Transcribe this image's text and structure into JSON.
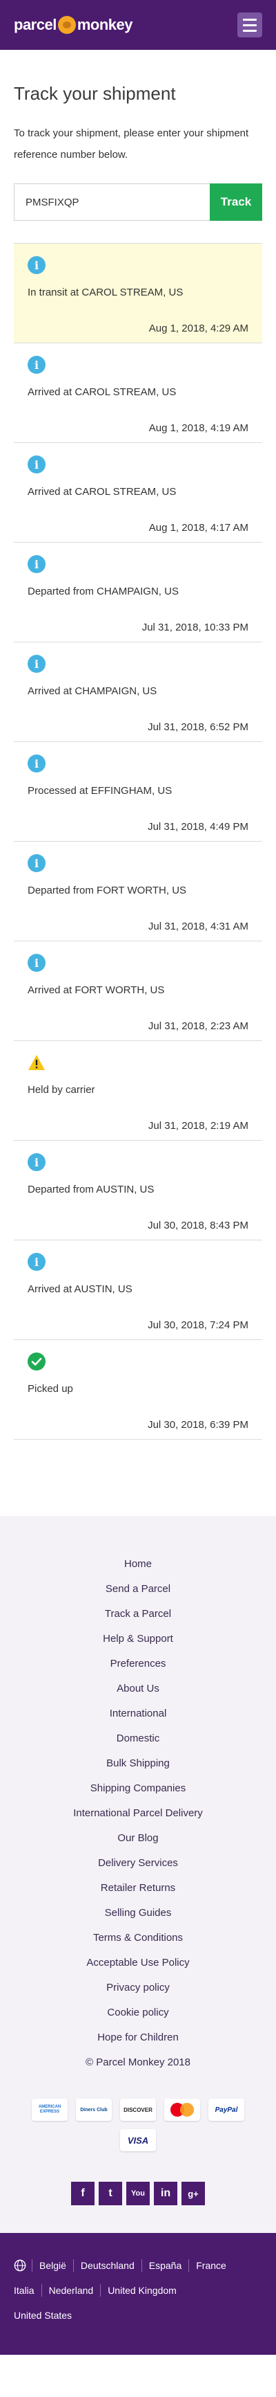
{
  "header": {
    "logo_left": "parcel",
    "logo_right": "monkey",
    "menu_icon": "hamburger-icon"
  },
  "page": {
    "title": "Track your shipment",
    "intro": "To track your shipment, please enter your shipment reference number below."
  },
  "form": {
    "reference": "PMSFIXQP",
    "button_label": "Track"
  },
  "events": [
    {
      "icon": "info-icon",
      "status": "In transit at CAROL STREAM, US",
      "time": "Aug 1, 2018, 4:29 AM",
      "current": true
    },
    {
      "icon": "info-icon",
      "status": "Arrived at CAROL STREAM, US",
      "time": "Aug 1, 2018, 4:19 AM"
    },
    {
      "icon": "info-icon",
      "status": "Arrived at CAROL STREAM, US",
      "time": "Aug 1, 2018, 4:17 AM"
    },
    {
      "icon": "info-icon",
      "status": "Departed from CHAMPAIGN, US",
      "time": "Jul 31, 2018, 10:33 PM"
    },
    {
      "icon": "info-icon",
      "status": "Arrived at CHAMPAIGN, US",
      "time": "Jul 31, 2018, 6:52 PM"
    },
    {
      "icon": "info-icon",
      "status": "Processed at EFFINGHAM, US",
      "time": "Jul 31, 2018, 4:49 PM"
    },
    {
      "icon": "info-icon",
      "status": "Departed from FORT WORTH, US",
      "time": "Jul 31, 2018, 4:31 AM"
    },
    {
      "icon": "info-icon",
      "status": "Arrived at FORT WORTH, US",
      "time": "Jul 31, 2018, 2:23 AM"
    },
    {
      "icon": "warning-icon",
      "status": "Held by carrier",
      "time": "Jul 31, 2018, 2:19 AM"
    },
    {
      "icon": "info-icon",
      "status": "Departed from AUSTIN, US",
      "time": "Jul 30, 2018, 8:43 PM"
    },
    {
      "icon": "info-icon",
      "status": "Arrived at AUSTIN, US",
      "time": "Jul 30, 2018, 7:24 PM"
    },
    {
      "icon": "check-icon",
      "status": "Picked up",
      "time": "Jul 30, 2018, 6:39 PM"
    }
  ],
  "footer": {
    "links": [
      "Home",
      "Send a Parcel",
      "Track a Parcel",
      "Help & Support",
      "Preferences",
      "About Us",
      "International",
      "Domestic",
      "Bulk Shipping",
      "Shipping Companies",
      "International Parcel Delivery",
      "Our Blog",
      "Delivery Services",
      "Retailer Returns",
      "Selling Guides",
      "Terms & Conditions",
      "Acceptable Use Policy",
      "Privacy policy",
      "Cookie policy",
      "Hope for Children"
    ],
    "copyright": "© Parcel Monkey 2018",
    "payments": [
      "AMERICAN EXPRESS",
      "Diners Club",
      "DISCOVER",
      "",
      "PayPal",
      "VISA"
    ],
    "social": [
      "f",
      "t",
      "You",
      "in",
      "g+"
    ]
  },
  "languages": {
    "row1": [
      "België",
      "Deutschland",
      "España",
      "France"
    ],
    "row2": [
      "Italia",
      "Nederland",
      "United Kingdom"
    ],
    "row3": [
      "United States"
    ]
  },
  "colors": {
    "brand": "#4b1b6e",
    "accent": "#1fab54",
    "info": "#45b3e1",
    "current_row": "#fdfbd9"
  }
}
